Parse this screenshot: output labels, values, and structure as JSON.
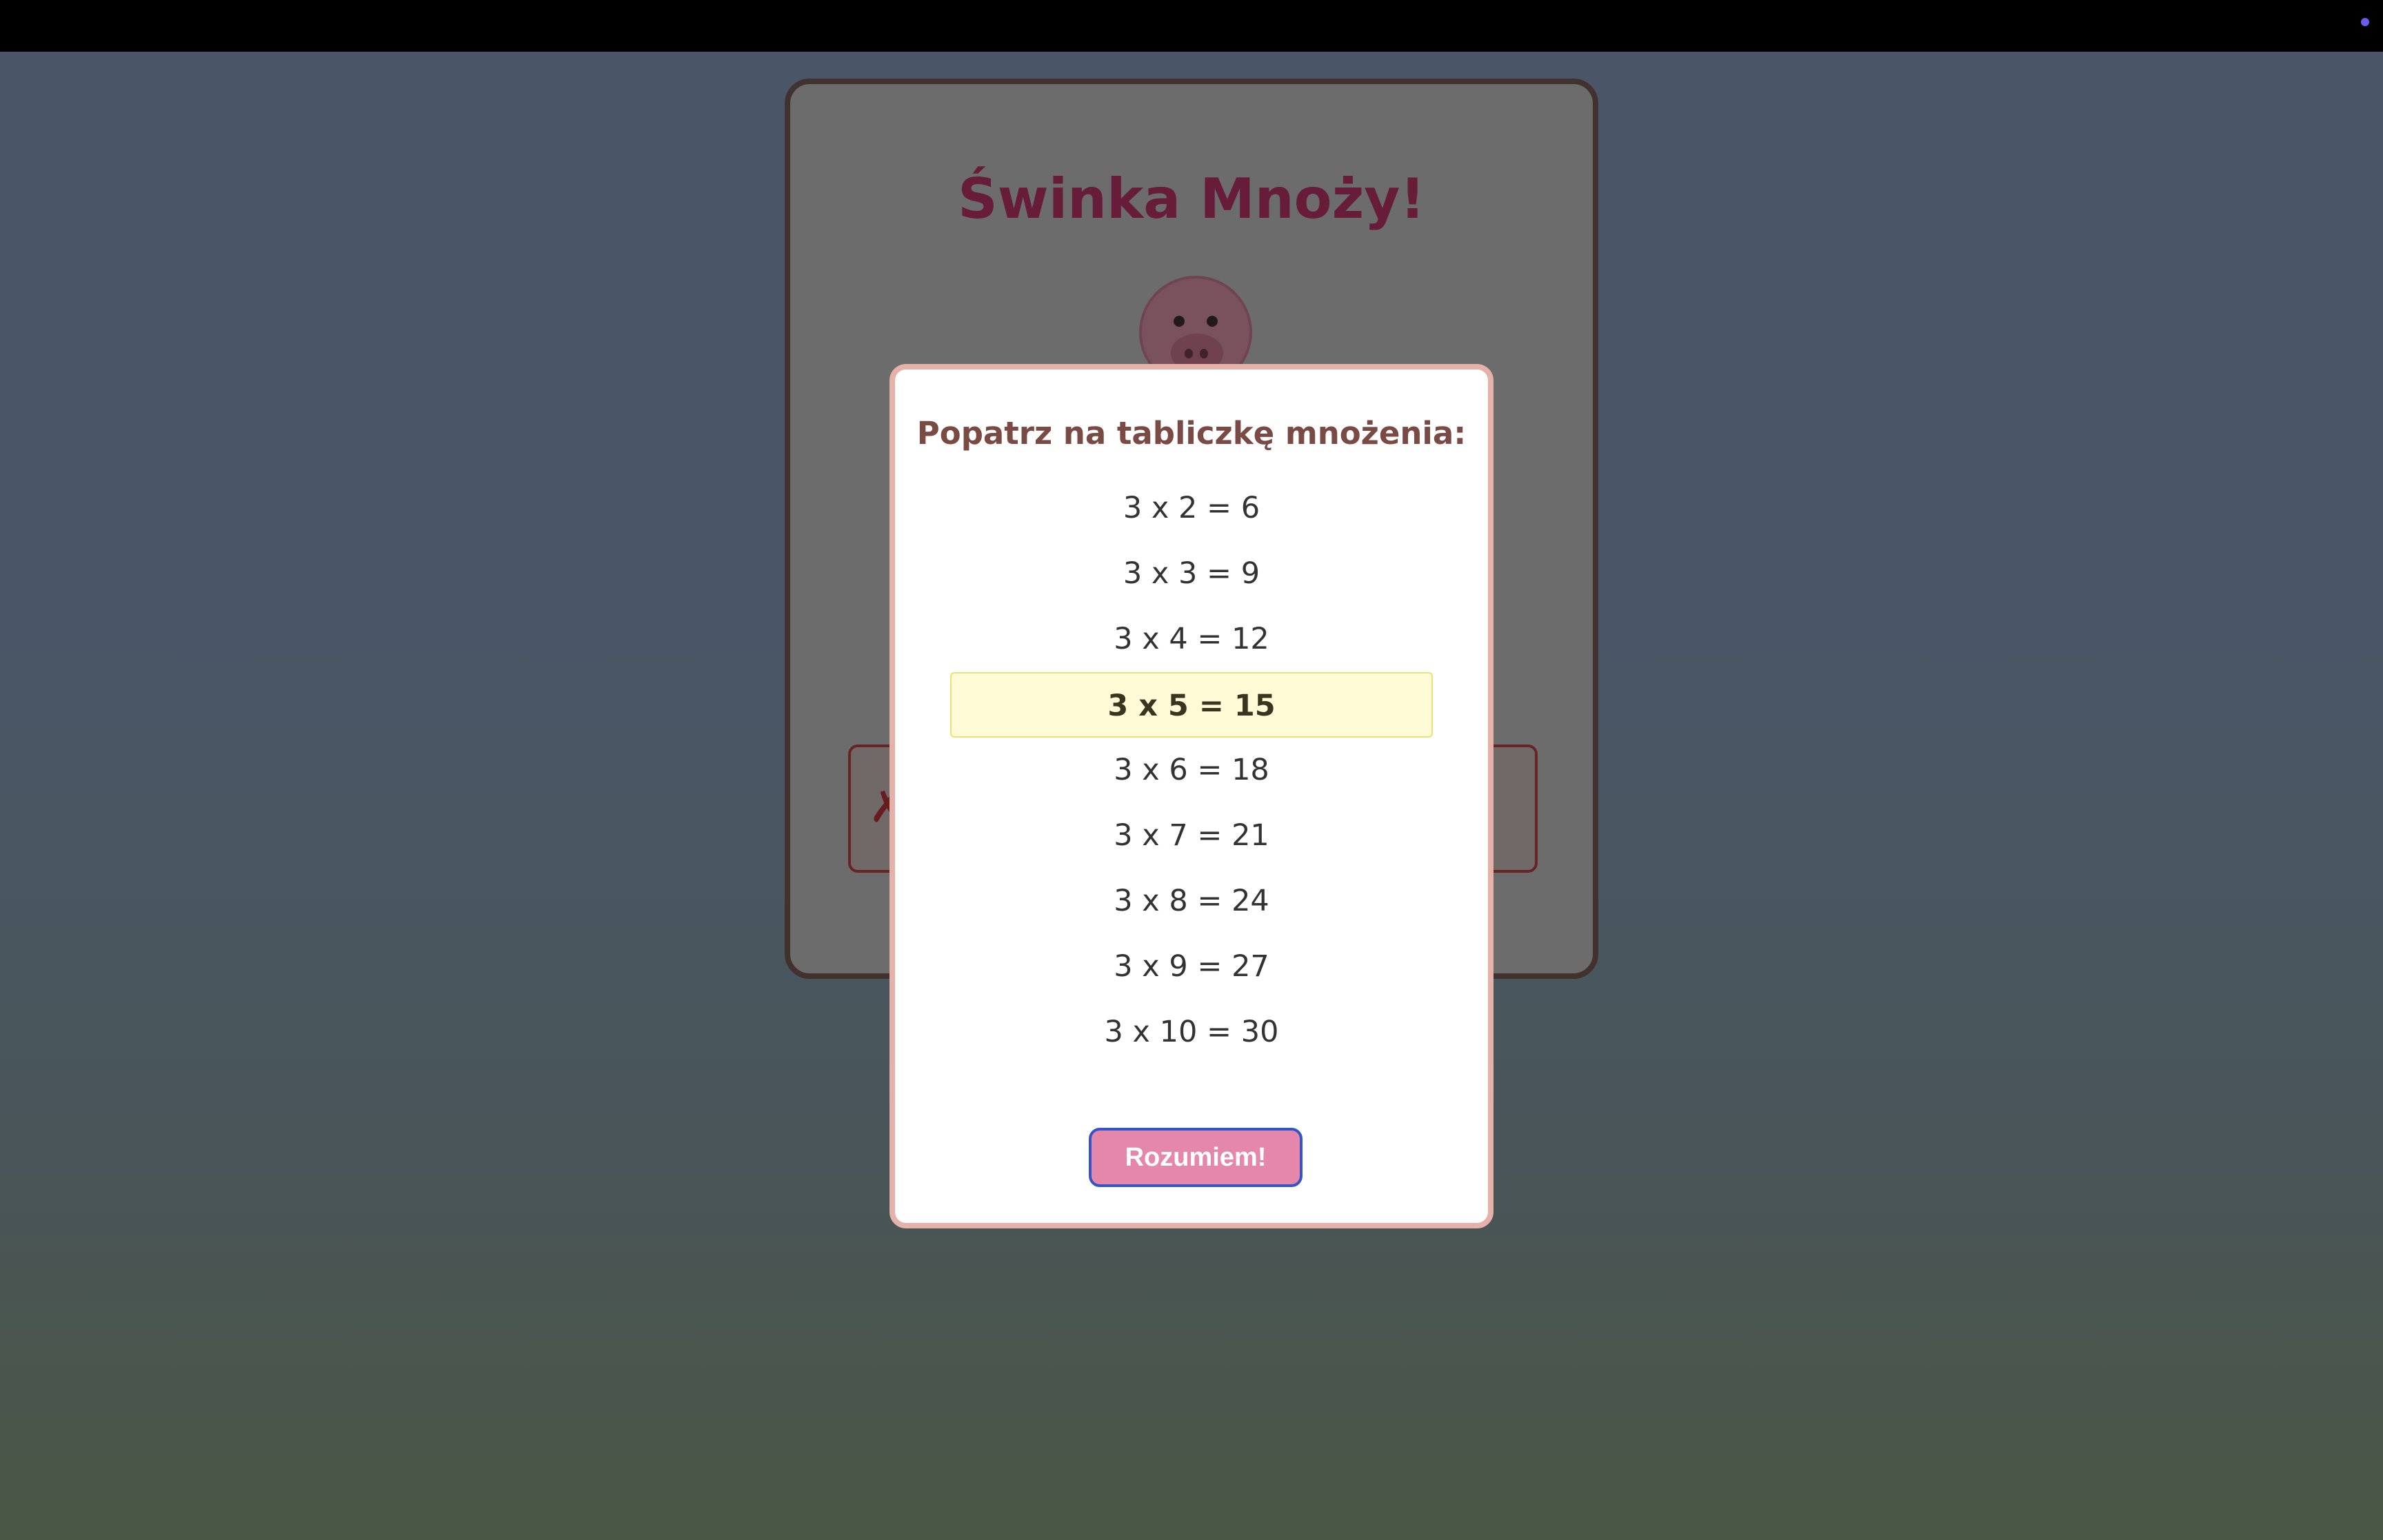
{
  "colors": {
    "accent": "#e587ab",
    "title": "#c4306b",
    "highlight": "#fffbd6",
    "modal_border": "#e4b2a8"
  },
  "game": {
    "title": "Świnka Mnoży!",
    "answer_mark": "✗"
  },
  "modal": {
    "title": "Popatrz na tabliczkę mnożenia:",
    "rows": [
      "3 x 2 = 6",
      "3 x 3 = 9",
      "3 x 4 = 12",
      "3 x 5 = 15",
      "3 x 6 = 18",
      "3 x 7 = 21",
      "3 x 8 = 24",
      "3 x 9 = 27",
      "3 x 10 = 30"
    ],
    "highlighted_row": "3 x 5 = 15",
    "confirm_label": "Rozumiem!"
  }
}
